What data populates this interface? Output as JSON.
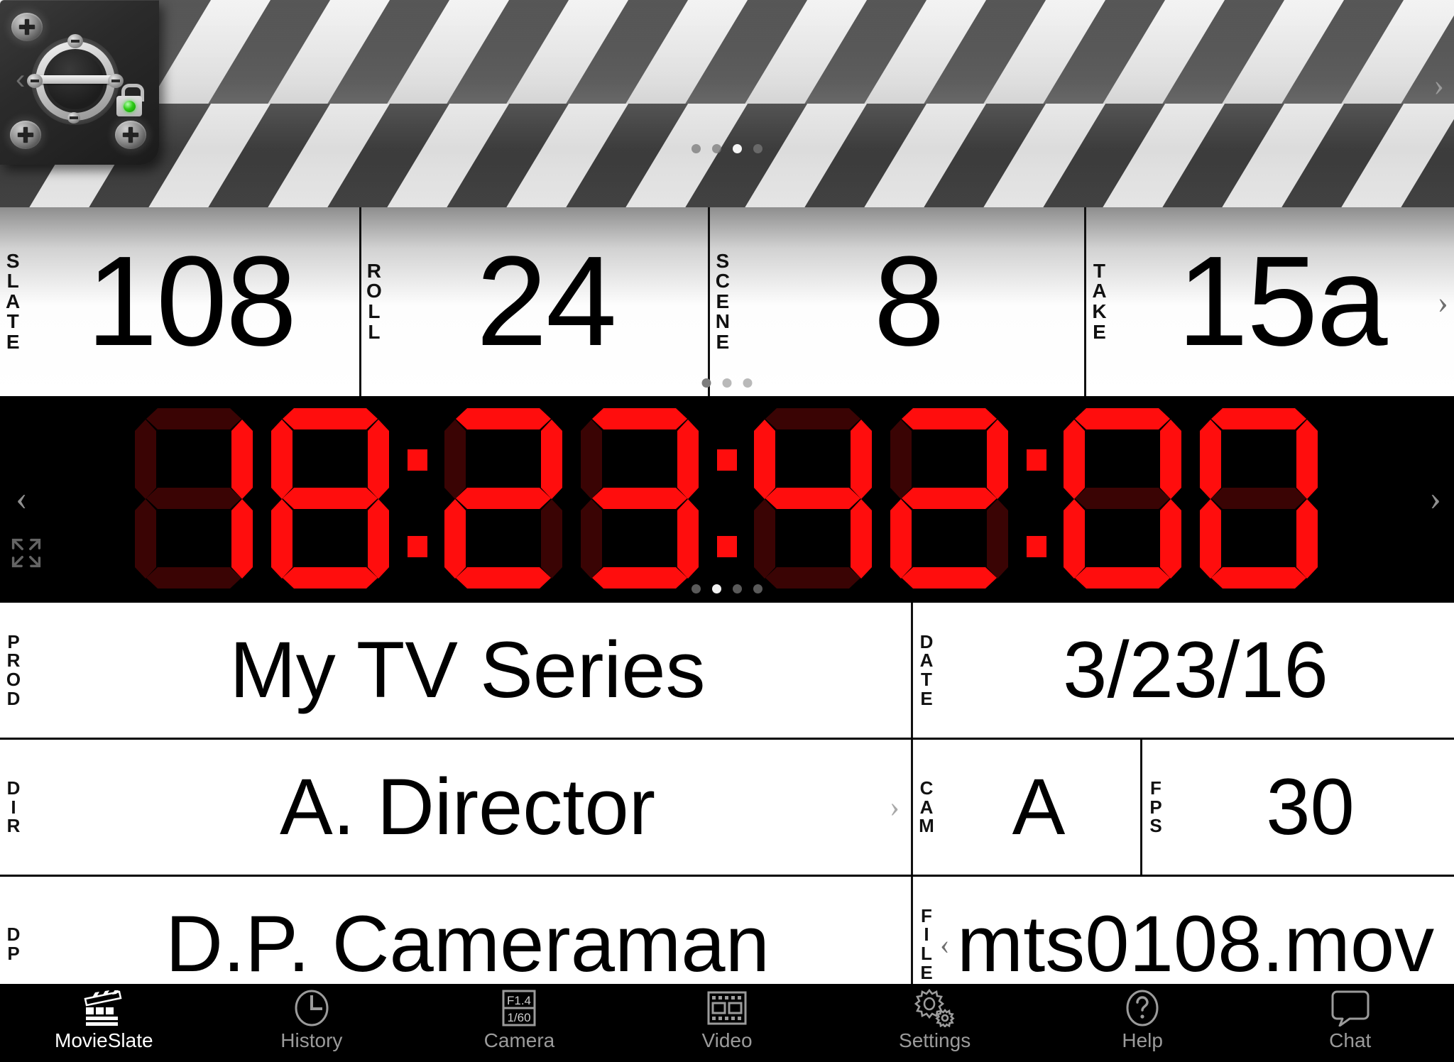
{
  "app": {
    "name": "MovieSlate"
  },
  "clapper": {
    "lock_state": "unlocked",
    "led_color": "#2ecb17",
    "nav_prev": "‹",
    "nav_next": "›",
    "dots": {
      "count": 4,
      "active_index": 2
    }
  },
  "slate_row": {
    "fields": [
      {
        "label": "SLATE",
        "letters": [
          "S",
          "L",
          "A",
          "T",
          "E"
        ],
        "value": "108"
      },
      {
        "label": "ROLL",
        "letters": [
          "R",
          "O",
          "L",
          "L"
        ],
        "value": "24"
      },
      {
        "label": "SCENE",
        "letters": [
          "S",
          "C",
          "E",
          "N",
          "E"
        ],
        "value": "8"
      },
      {
        "label": "TAKE",
        "letters": [
          "T",
          "A",
          "K",
          "E"
        ],
        "value": "15a"
      }
    ],
    "nav_next": "›",
    "dots": {
      "count": 3,
      "active_index": 0
    }
  },
  "timecode": {
    "value": "18:23:42:00",
    "hours": "18",
    "minutes": "23",
    "seconds": "42",
    "frames": "00",
    "digits": [
      "1",
      "8",
      "2",
      "3",
      "4",
      "2",
      "0",
      "0"
    ],
    "color_on": "#ff0d0d",
    "color_off": "#3a0404",
    "nav_prev": "‹",
    "nav_next": "›",
    "expand_icon": "expand-arrows-icon",
    "dots": {
      "count": 4,
      "active_index": 1
    }
  },
  "rows": {
    "prod": {
      "label": "PROD",
      "letters": [
        "P",
        "R",
        "O",
        "D"
      ],
      "value": "My TV Series"
    },
    "date": {
      "label": "DATE",
      "letters": [
        "D",
        "A",
        "T",
        "E"
      ],
      "value": "3/23/16"
    },
    "dir": {
      "label": "DIR",
      "letters": [
        "D",
        "I",
        "R"
      ],
      "value": "A. Director",
      "chevron": "›"
    },
    "cam": {
      "label": "CAM",
      "letters": [
        "C",
        "A",
        "M"
      ],
      "value": "A"
    },
    "fps": {
      "label": "FPS",
      "letters": [
        "F",
        "P",
        "S"
      ],
      "value": "30"
    },
    "dp": {
      "label": "DP",
      "letters": [
        "D",
        "P"
      ],
      "value": "D.P. Cameraman"
    },
    "file": {
      "label": "FILE",
      "letters": [
        "F",
        "I",
        "L",
        "E"
      ],
      "value": "mts0108.mov",
      "chevron": "‹"
    },
    "dp_dots": {
      "count": 3,
      "active_index": 1
    },
    "file_dots": {
      "count": 2,
      "active_index": 1
    }
  },
  "tabbar": {
    "active": "MovieSlate",
    "items": [
      {
        "label": "MovieSlate",
        "icon": "clapperboard-icon"
      },
      {
        "label": "History",
        "icon": "clock-icon"
      },
      {
        "label": "Camera",
        "icon": "aperture-shutter-icon",
        "icon_text_top": "F1.4",
        "icon_text_bottom": "1/60"
      },
      {
        "label": "Video",
        "icon": "film-strip-icon"
      },
      {
        "label": "Settings",
        "icon": "gear-icon"
      },
      {
        "label": "Help",
        "icon": "question-mark-circle-icon"
      },
      {
        "label": "Chat",
        "icon": "speech-bubble-icon"
      }
    ]
  }
}
